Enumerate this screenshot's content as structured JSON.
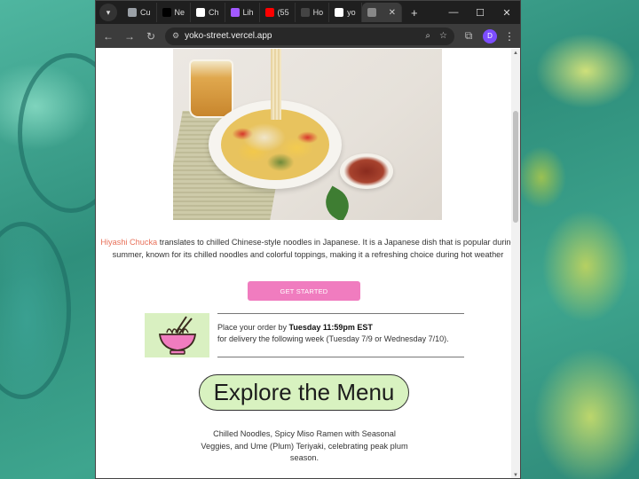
{
  "tabs": [
    {
      "label": "Cu",
      "color": "#9aa0a6"
    },
    {
      "label": "Ne",
      "color": "#000000"
    },
    {
      "label": "Ch",
      "color": "#ffffff"
    },
    {
      "label": "Lih",
      "color": "#a259ff"
    },
    {
      "label": "(55",
      "color": "#ff0000"
    },
    {
      "label": "Ho",
      "color": "#444444"
    },
    {
      "label": "yo",
      "color": "#ffffff"
    },
    {
      "label": "",
      "color": "#888888",
      "active": true
    }
  ],
  "url": "yoko-street.vercel.app",
  "profile_initial": "D",
  "intro": {
    "highlight": "Hiyashi Chucka",
    "text": " translates to chilled Chinese-style noodles in Japanese. It is a Japanese dish that is popular during summer, known for its chilled noodles and colorful toppings, making it a refreshing choice during hot weather"
  },
  "cta_label": "GET STARTED",
  "order": {
    "prefix": "Place your order by ",
    "deadline": "Tuesday 11:59pm EST",
    "line2": "for delivery the following week (Tuesday 7/9 or Wednesday 7/10)."
  },
  "menu_title": "Explore the Menu",
  "menu_description": "Chilled Noodles, Spicy Miso Ramen with Seasonal Veggies, and Ume (Plum) Teriyaki, celebrating peak plum season.",
  "colors": {
    "accent_pink": "#f07cbf",
    "highlight_orange": "#e8715a",
    "pill_green": "#d8f2c0"
  }
}
